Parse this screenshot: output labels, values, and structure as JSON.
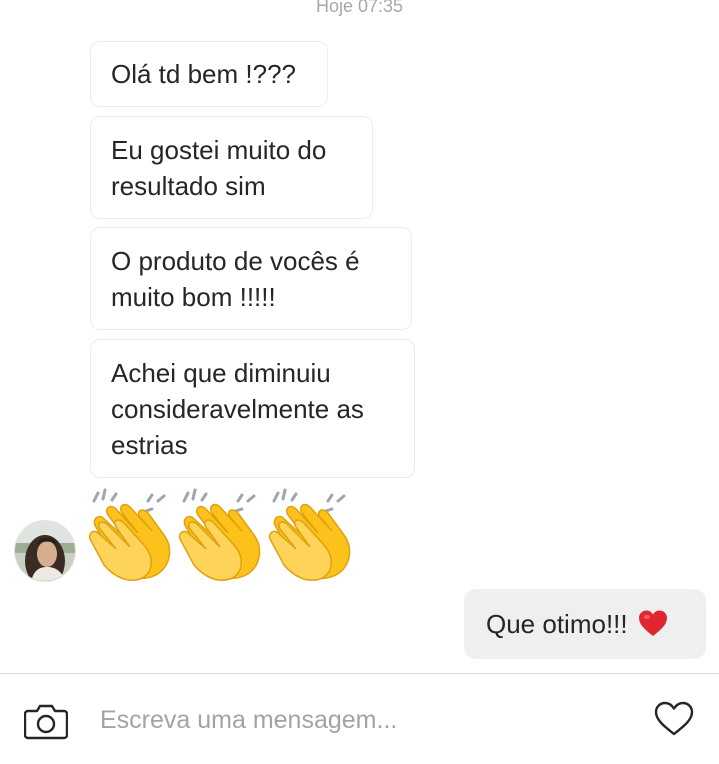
{
  "header": {
    "timestamp": "Hoje 07:35"
  },
  "messages_received": [
    {
      "text": "Olá td bem !???"
    },
    {
      "lines": [
        "Eu gostei muito do",
        "resultado sim"
      ]
    },
    {
      "lines": [
        "O produto de vocês é",
        "muito bom !!!!!"
      ]
    },
    {
      "lines": [
        "Achei que diminuiu",
        "consideravelmente as",
        "estrias"
      ]
    }
  ],
  "emoji_message": {
    "emoji": "clapping-hands",
    "count": 3
  },
  "message_sent": {
    "text": "Que otimo!!!",
    "emoji": "red-heart"
  },
  "composer": {
    "placeholder": "Escreva uma mensagem..."
  },
  "icons": {
    "camera": "camera-icon",
    "like": "heart-outline-icon"
  },
  "colors": {
    "timestamp": "#a8a8a8",
    "sent_bubble": "#efefef",
    "received_border": "#ececec",
    "heart": "#e0262f",
    "clap": "#fcc21b"
  }
}
